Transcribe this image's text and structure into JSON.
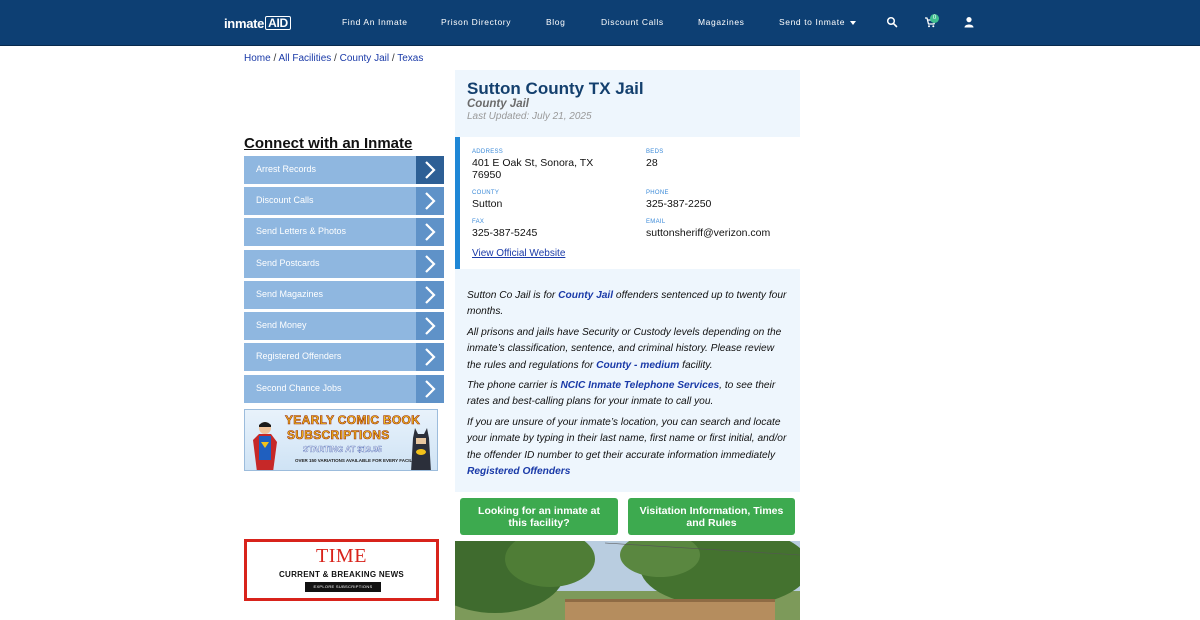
{
  "nav": {
    "logo_main": "inmate",
    "logo_aid": "AID",
    "links": [
      {
        "label": "Find An Inmate"
      },
      {
        "label": "Prison Directory"
      },
      {
        "label": "Blog"
      },
      {
        "label": "Discount Calls"
      },
      {
        "label": "Magazines"
      },
      {
        "label": "Send to Inmate"
      }
    ],
    "cart_count": "0",
    "icons": [
      "search-icon",
      "cart-icon",
      "user-icon"
    ]
  },
  "breadcrumb": {
    "items": [
      "Home",
      "All Facilities",
      "County Jail",
      "Texas"
    ],
    "separator": " / "
  },
  "sidebar": {
    "title": "Connect with an Inmate",
    "items": [
      {
        "label": "Arrest Records"
      },
      {
        "label": "Discount Calls"
      },
      {
        "label": "Send Letters & Photos"
      },
      {
        "label": "Send Postcards"
      },
      {
        "label": "Send Magazines"
      },
      {
        "label": "Send Money"
      },
      {
        "label": "Registered Offenders"
      },
      {
        "label": "Second Chance Jobs"
      }
    ],
    "comic_ad": {
      "line1": "YEARLY COMIC BOOK",
      "line2": "SUBSCRIPTIONS",
      "line3": "STARTING AT $19.95",
      "line4": "OVER 150 VARIATIONS AVAILABLE FOR EVERY FACILITY"
    },
    "time_ad": {
      "brand": "TIME",
      "tagline": "CURRENT & BREAKING NEWS",
      "cta": "EXPLORE SUBSCRIPTIONS"
    }
  },
  "facility": {
    "name": "Sutton County TX Jail",
    "type": "County Jail",
    "updated": "Last Updated: July 21, 2025",
    "address_label": "ADDRESS",
    "address_line1": "401 E Oak St, Sonora, TX",
    "address_line2": "76950",
    "beds_label": "BEDS",
    "beds": "28",
    "county_label": "COUNTY",
    "county": "Sutton",
    "phone_label": "PHONE",
    "phone": "325-387-2250",
    "fax_label": "FAX",
    "fax": "325-387-5245",
    "email_label": "EMAIL",
    "email": "suttonsheriff@verizon.com",
    "website_link": "View Official Website"
  },
  "description": {
    "p1_a": "Sutton Co Jail is for ",
    "p1_link": "County Jail",
    "p1_b": " offenders sentenced up to twenty four months.",
    "p2_a": "All prisons and jails have Security or Custody levels depending on the inmate’s classification, sentence, and criminal history. Please review the rules and regulations for ",
    "p2_link": "County - medium",
    "p2_b": " facility.",
    "p3_a": "The phone carrier is ",
    "p3_link": "NCIC Inmate Telephone Services",
    "p3_b": ", to see their rates and best-calling plans for your inmate to call you.",
    "p4_a": "If you are unsure of your inmate’s location, you can search and locate your inmate by typing in their last name, first name or first initial, and/or the offender ID number to get their accurate information immediately ",
    "p4_link": "Registered Offenders"
  },
  "buttons": {
    "looking": "Looking for an inmate at this facility?",
    "visitation": "Visitation Information, Times and Rules"
  },
  "colors": {
    "nav_bg": "#0d3f73",
    "sidebar_item": "#8fb7e0",
    "sidebar_chevron": "#5f92c8",
    "panel_bg": "#eef6fd",
    "accent_bar": "#1f87d6",
    "green_button": "#3daa4f",
    "link": "#1a3aa8"
  }
}
